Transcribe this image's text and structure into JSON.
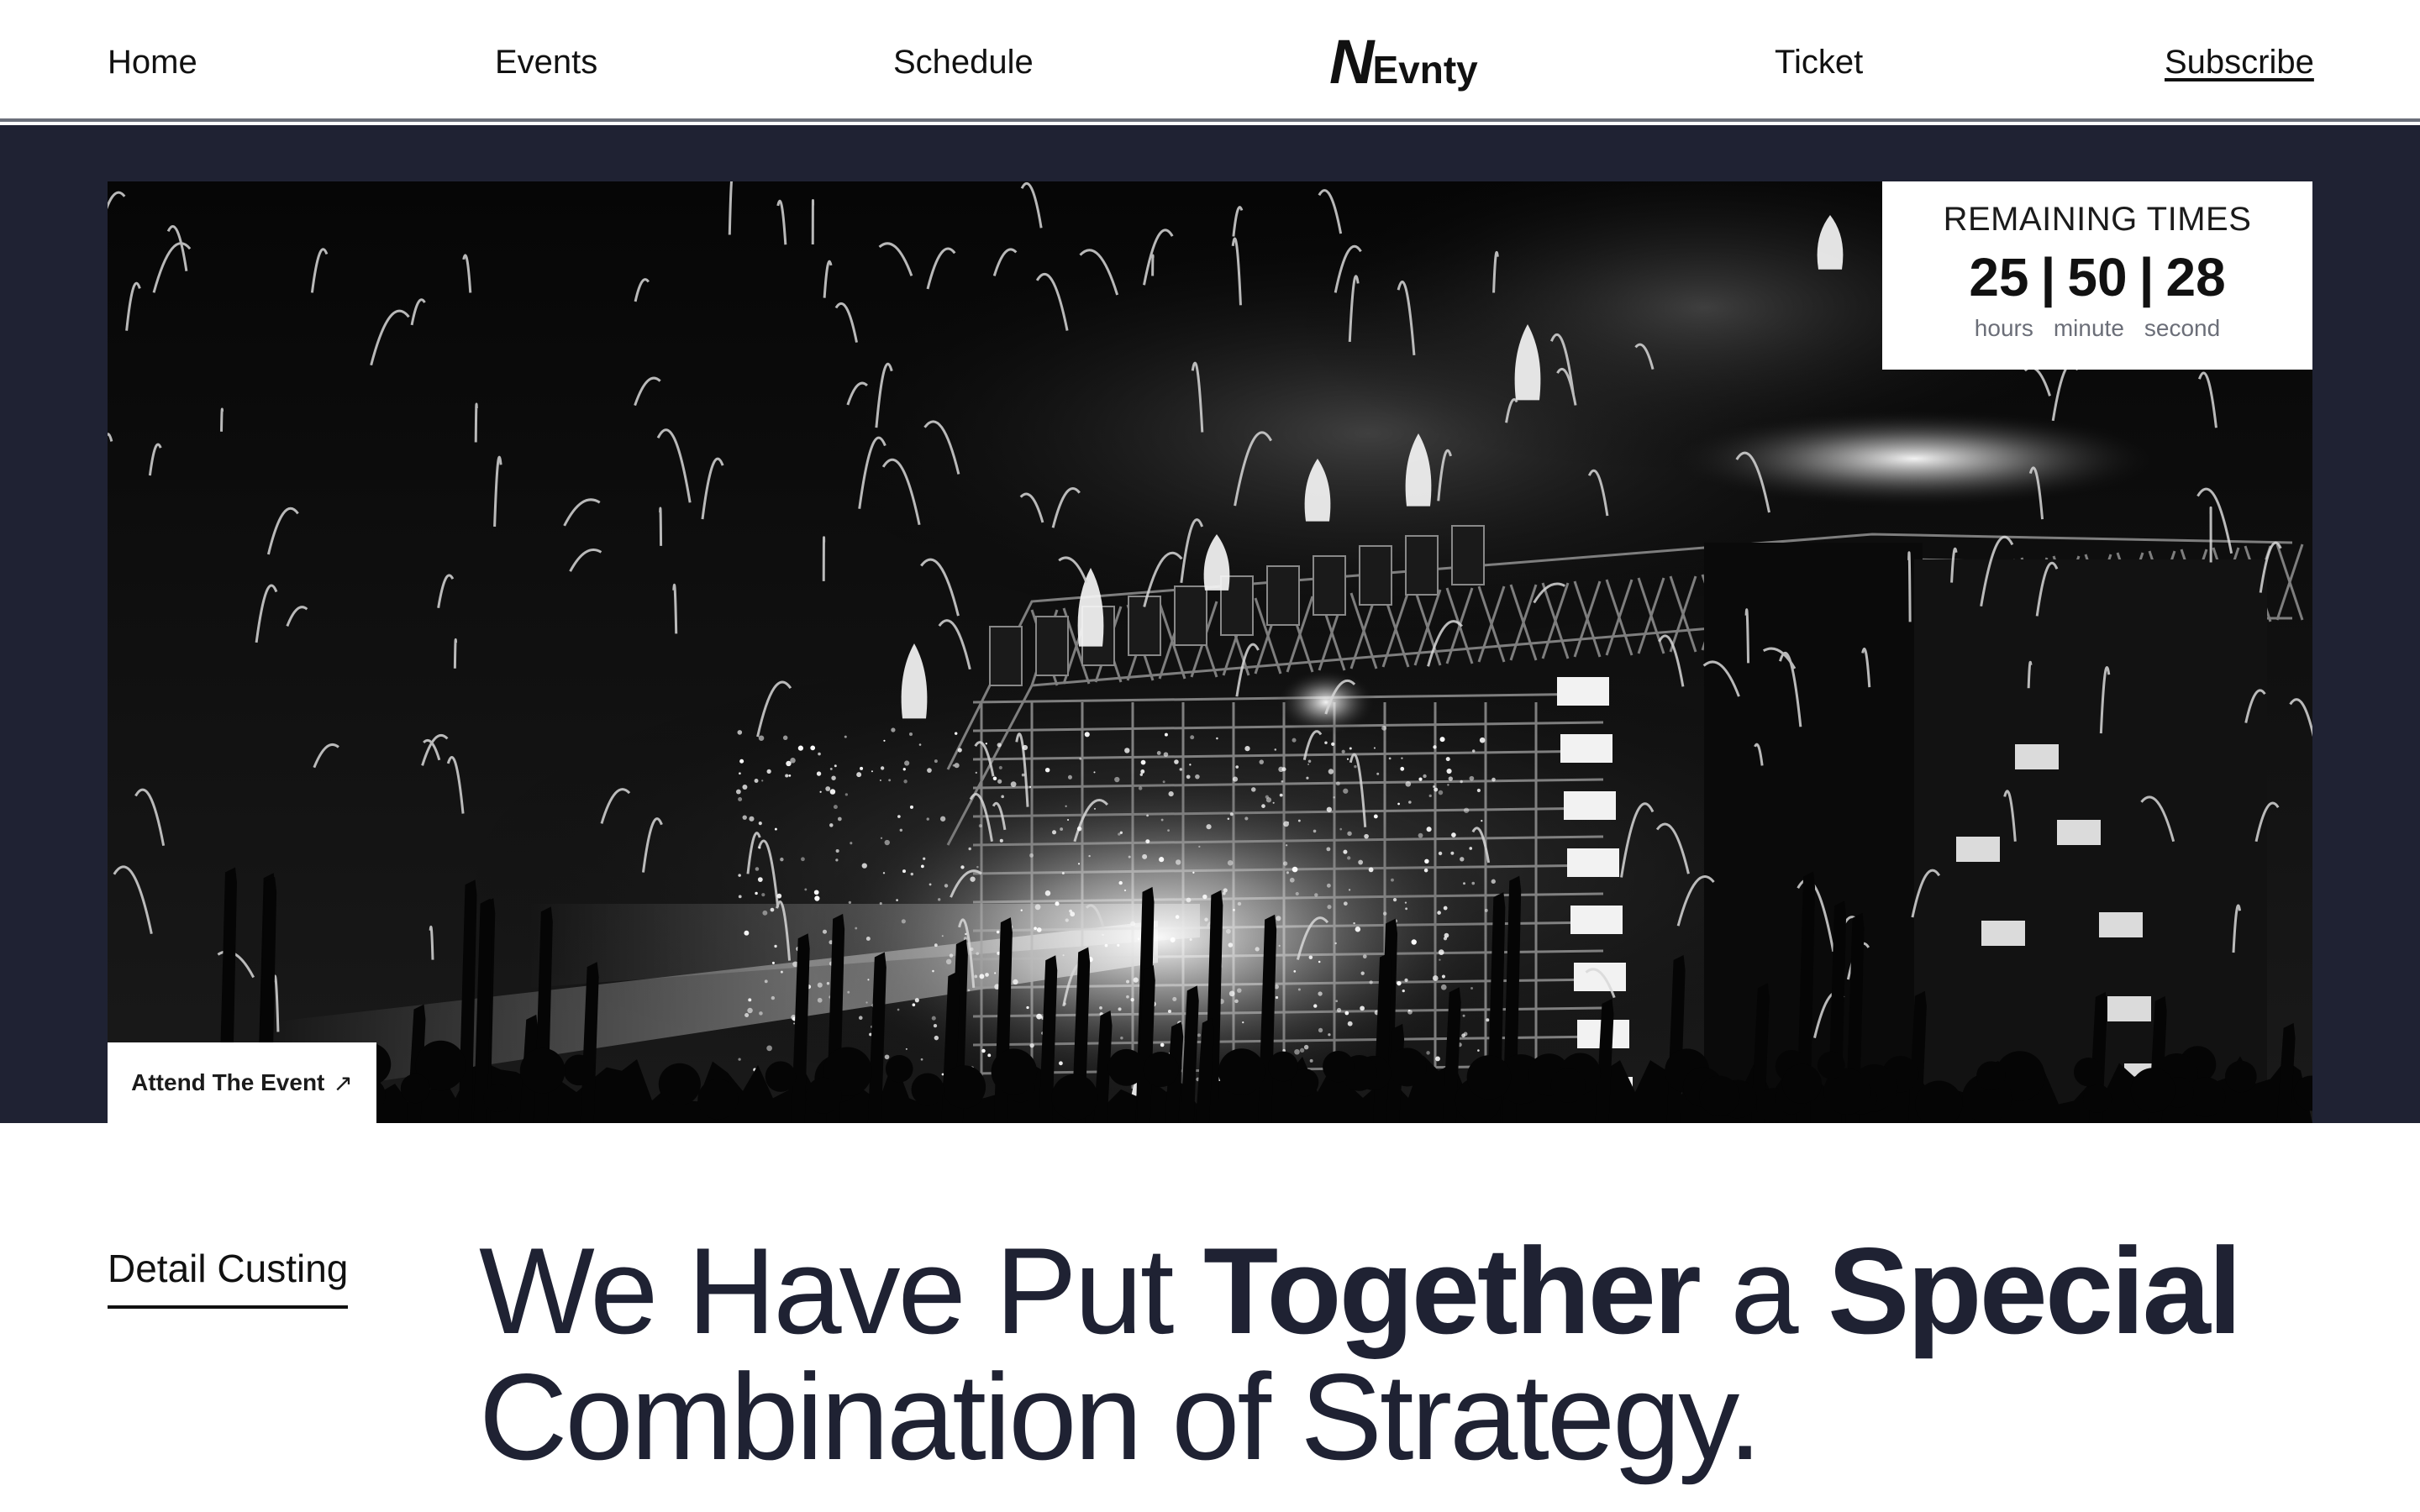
{
  "nav": {
    "home": "Home",
    "events": "Events",
    "schedule": "Schedule",
    "logo_initial": "N",
    "logo_text": "Evnty",
    "ticket": "Ticket",
    "subscribe": "Subscribe"
  },
  "countdown": {
    "title": "REMAINING TIMES",
    "hours": "25",
    "minutes": "50",
    "seconds": "28",
    "separator": "|",
    "hours_label": "hours",
    "minutes_label": "minute",
    "seconds_label": "second"
  },
  "hero": {
    "cta_label": "Attend The Event",
    "cta_icon": "arrow-up-right-icon"
  },
  "content": {
    "section_label": "Detail Custing",
    "headline_part1": "We Have Put ",
    "headline_bold1": "Together",
    "headline_part2": " a ",
    "headline_bold2": "Special",
    "headline_line2": "Combination of Strategy."
  },
  "colors": {
    "navy": "#1f2233",
    "white": "#ffffff",
    "text": "#111111"
  }
}
